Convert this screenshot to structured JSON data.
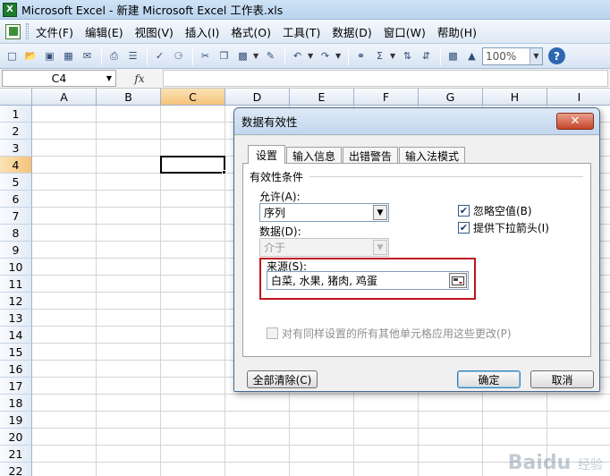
{
  "window": {
    "title": "Microsoft Excel - 新建 Microsoft Excel 工作表.xls"
  },
  "menu": [
    "文件(F)",
    "编辑(E)",
    "视图(V)",
    "插入(I)",
    "格式(O)",
    "工具(T)",
    "数据(D)",
    "窗口(W)",
    "帮助(H)"
  ],
  "toolbar": {
    "zoom": "100%"
  },
  "formula_bar": {
    "name_box": "C4",
    "fx_label": "fx",
    "content": ""
  },
  "grid": {
    "columns": [
      "A",
      "B",
      "C",
      "D",
      "E",
      "F",
      "G",
      "H",
      "I"
    ],
    "rows": [
      "1",
      "2",
      "3",
      "4",
      "5",
      "6",
      "7",
      "8",
      "9",
      "10",
      "11",
      "12",
      "13",
      "14",
      "15",
      "16",
      "17",
      "18",
      "19",
      "20",
      "21",
      "22"
    ],
    "active_column": "C",
    "active_row": "4"
  },
  "dialog": {
    "title": "数据有效性",
    "close_label": "✕",
    "tabs": [
      "设置",
      "输入信息",
      "出错警告",
      "输入法模式"
    ],
    "active_tab": "设置",
    "group_title": "有效性条件",
    "allow_label": "允许(A):",
    "allow_value": "序列",
    "data_label": "数据(D):",
    "data_value": "介于",
    "ignore_blank_label": "忽略空值(B)",
    "ignore_blank_checked": true,
    "dropdown_label": "提供下拉箭头(I)",
    "dropdown_checked": true,
    "source_label": "来源(S):",
    "source_value": "白菜, 水果, 猪肉, 鸡蛋",
    "apply_all_label": "对有同样设置的所有其他单元格应用这些更改(P)",
    "apply_all_checked": false,
    "clear_all_label": "全部清除(C)",
    "ok_label": "确定",
    "cancel_label": "取消"
  },
  "watermark": {
    "brand": "Bai",
    "paw": "du",
    "suffix": "经验"
  }
}
